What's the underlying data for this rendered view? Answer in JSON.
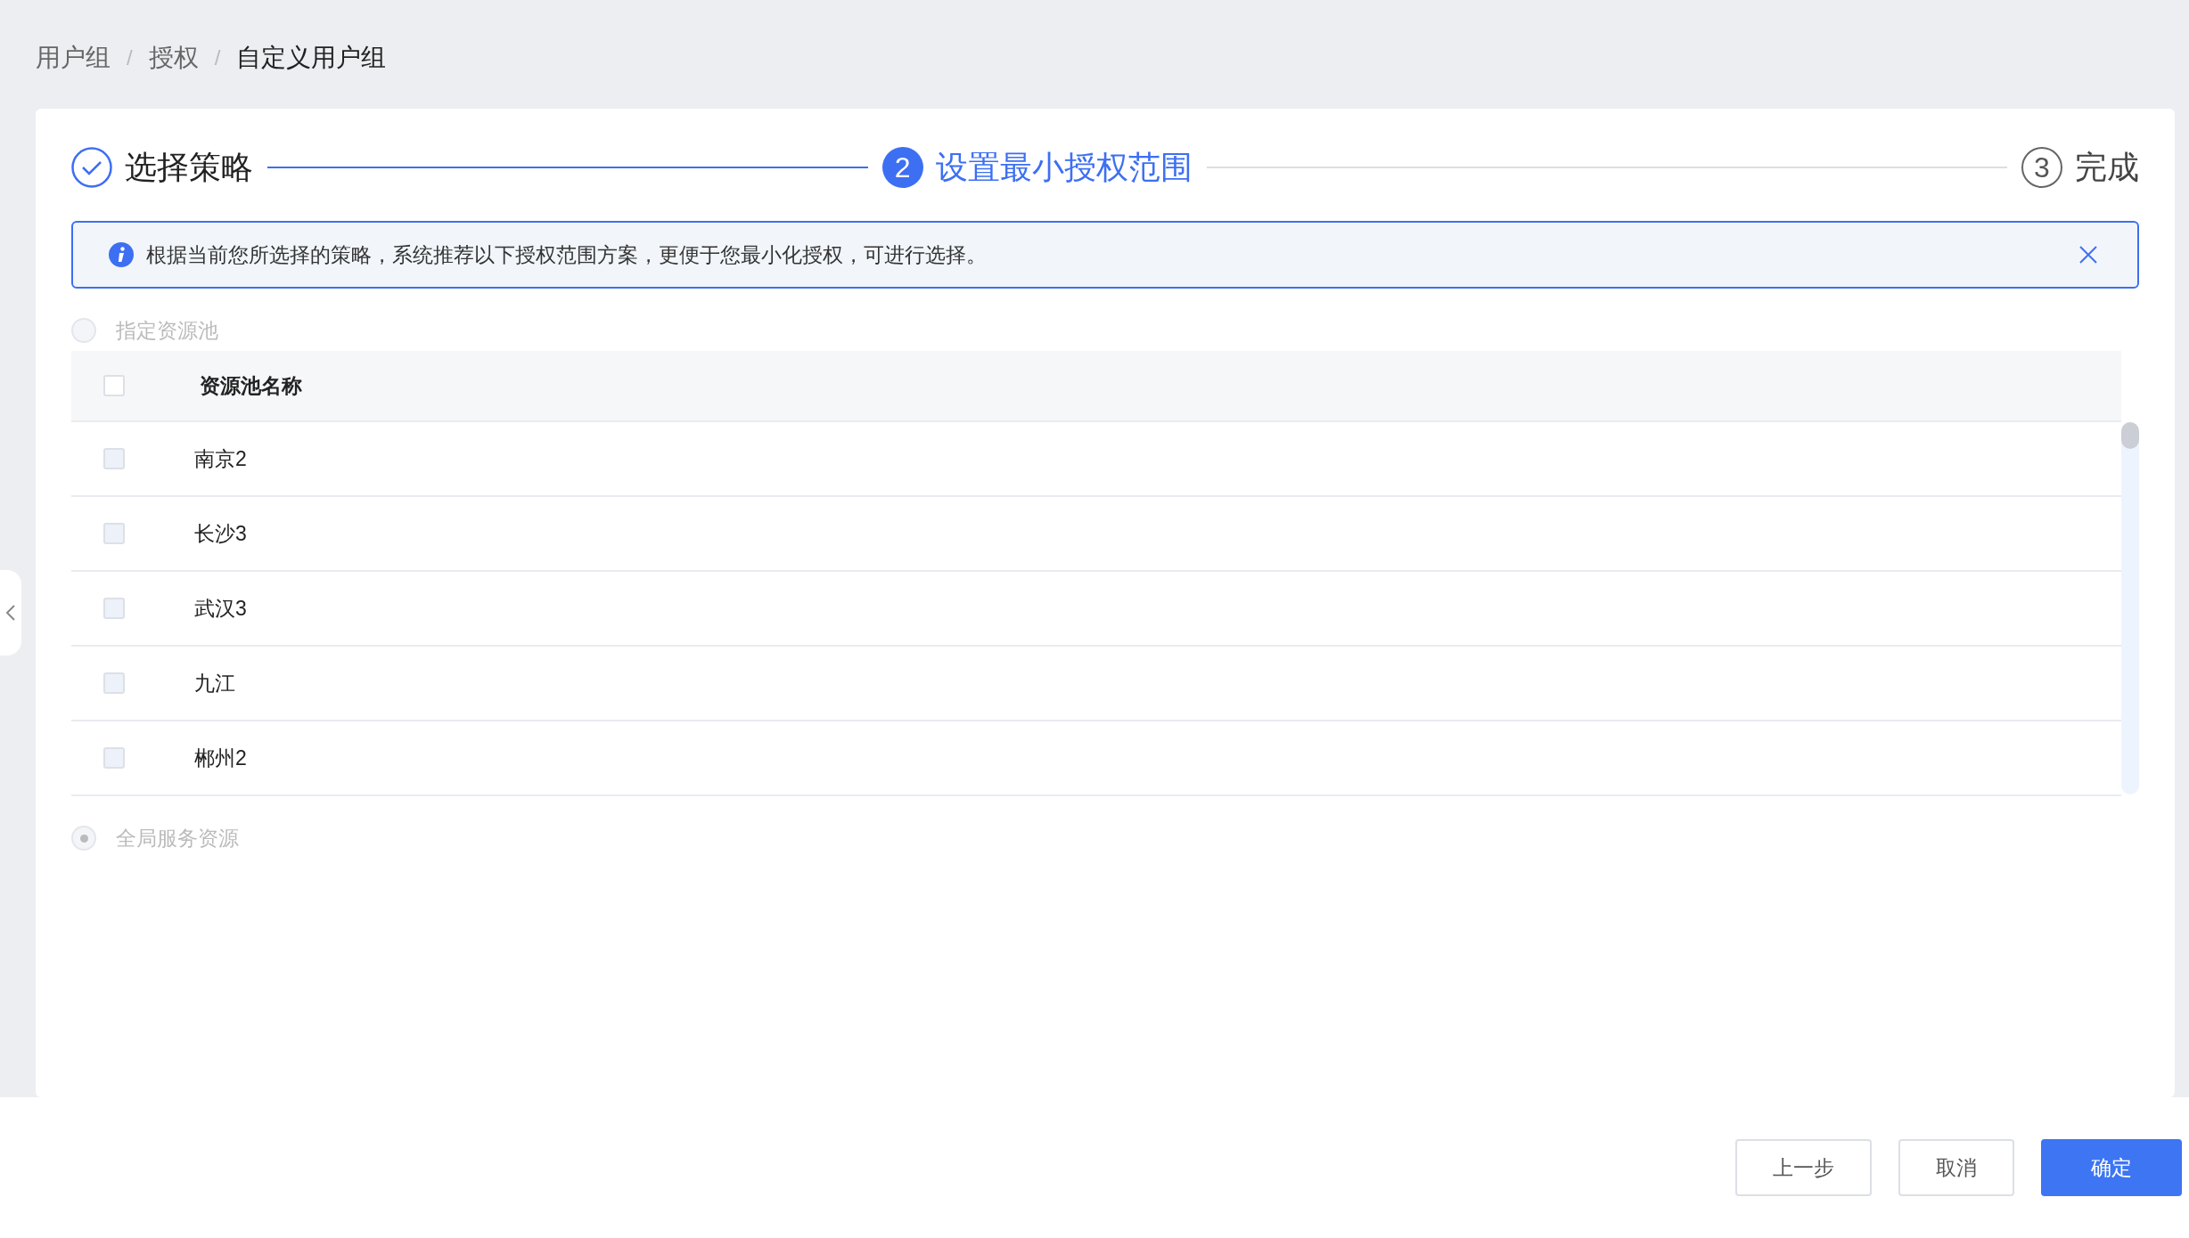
{
  "breadcrumb": [
    {
      "label": "用户组",
      "current": false
    },
    {
      "label": "授权",
      "current": false
    },
    {
      "label": "自定义用户组",
      "current": true
    }
  ],
  "breadcrumb_separator": "/",
  "steps": [
    {
      "label": "选择策略",
      "done": true,
      "selected": false
    },
    {
      "number": "2",
      "label": "设置最小授权范围",
      "done": false,
      "selected": true
    },
    {
      "number": "3",
      "label": "完成",
      "done": false,
      "selected": false
    }
  ],
  "alert": {
    "text": "根据当前您所选择的策略，系统推荐以下授权范围方案，更便于您最小化授权，可进行选择。"
  },
  "scope_options": [
    {
      "kind": "table",
      "label": "指定资源池",
      "selected": false,
      "disabled": true
    },
    {
      "kind": "plain",
      "label": "全局服务资源",
      "selected": true,
      "disabled": true
    }
  ],
  "table": {
    "columns": [
      "资源池名称"
    ],
    "header_checked": false,
    "rows": [
      {
        "name": "南京2",
        "checked": false
      },
      {
        "name": "长沙3",
        "checked": false
      },
      {
        "name": "武汉3",
        "checked": false
      },
      {
        "name": "九江",
        "checked": false
      },
      {
        "name": "郴州2",
        "checked": false
      }
    ]
  },
  "footer_buttons": [
    {
      "label": "上一步",
      "kind": "secondary"
    },
    {
      "label": "取消",
      "kind": "secondary"
    },
    {
      "label": "确定",
      "kind": "primary"
    }
  ]
}
